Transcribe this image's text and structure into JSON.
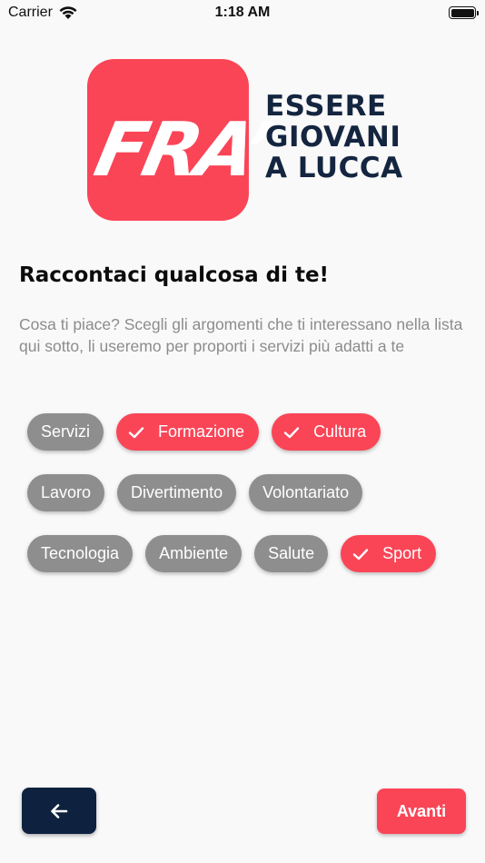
{
  "status_bar": {
    "carrier": "Carrier",
    "time": "1:18 AM"
  },
  "logo": {
    "badge_text": "FRA’",
    "line1": "ESSERE",
    "line2": "GIOVANI",
    "line3": "A LUCCA",
    "badge_color": "#fa4557",
    "text_color": "#142540"
  },
  "title": "Raccontaci qualcosa di te!",
  "description": "Cosa ti piace? Scegli gli argomenti che ti interessano nella lista qui sotto, li useremo per proporti i servizi più adatti a te",
  "chips": [
    {
      "label": "Servizi",
      "selected": false
    },
    {
      "label": "Formazione",
      "selected": true
    },
    {
      "label": "Cultura",
      "selected": true
    },
    {
      "label": "Lavoro",
      "selected": false
    },
    {
      "label": "Divertimento",
      "selected": false
    },
    {
      "label": "Volontariato",
      "selected": false
    },
    {
      "label": "Tecnologia",
      "selected": false
    },
    {
      "label": "Ambiente",
      "selected": false
    },
    {
      "label": "Salute",
      "selected": false
    },
    {
      "label": "Sport",
      "selected": true
    }
  ],
  "colors": {
    "selected": "#fa4557",
    "unselected": "#8e8e8e",
    "back_button": "#0e2240"
  },
  "buttons": {
    "back_icon": "arrow-left-icon",
    "next_label": "Avanti"
  }
}
